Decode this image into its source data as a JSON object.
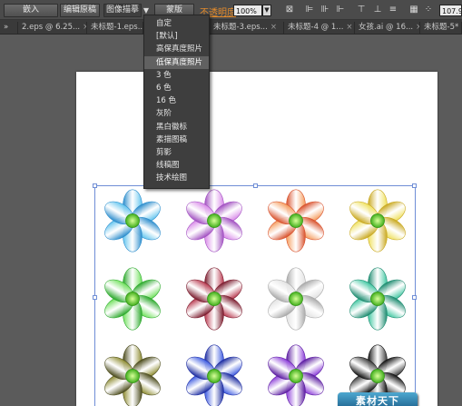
{
  "toolbar": {
    "embed_button": "嵌入",
    "edit_original_button": "编辑原稿",
    "image_trace_button": "图像描摹",
    "mask_button": "蒙版",
    "opacity_label": "不透明度",
    "opacity_value": "100%",
    "number_value": "107.9"
  },
  "tabs": [
    {
      "label": "2.eps @ 6.25..."
    },
    {
      "label": "未标题-1.eps..."
    },
    {
      "label": "未标题-3.eps..."
    },
    {
      "label": "未标题-4 @ 1..."
    },
    {
      "label": "女孩.ai @ 16..."
    },
    {
      "label": "未标题-5*"
    }
  ],
  "trace_menu": {
    "items": [
      {
        "label": "自定"
      },
      {
        "label": "[默认]"
      },
      {
        "label": "高保真度照片"
      },
      {
        "label": "低保真度照片",
        "highlighted": true
      },
      {
        "label": "3 色"
      },
      {
        "label": "6 色"
      },
      {
        "label": "16 色"
      },
      {
        "label": "灰阶"
      },
      {
        "label": "黑白徽标"
      },
      {
        "label": "素描图稿"
      },
      {
        "label": "剪影"
      },
      {
        "label": "线稿图"
      },
      {
        "label": "技术绘图"
      }
    ]
  },
  "watermark": {
    "text": "素材天下"
  },
  "flowers": [
    {
      "petal": "#5fc3ee",
      "edge": "#2a8ccc"
    },
    {
      "petal": "#d888e8",
      "edge": "#a04ec0"
    },
    {
      "petal": "#f59a5a",
      "edge": "#d8502a"
    },
    {
      "petal": "#efe05a",
      "edge": "#c9a81e"
    },
    {
      "petal": "#6ee05a",
      "edge": "#2aa82a"
    },
    {
      "petal": "#b8384e",
      "edge": "#7a1a2c"
    },
    {
      "petal": "#e2e2e2",
      "edge": "#a8a8a8"
    },
    {
      "petal": "#3ec6a0",
      "edge": "#1a8a6e"
    },
    {
      "petal": "#8c8a2e",
      "edge": "#4a4a1a"
    },
    {
      "petal": "#3a58e0",
      "edge": "#1a2aa0"
    },
    {
      "petal": "#8a3ad8",
      "edge": "#5a1aa0"
    },
    {
      "petal": "#3a3a3a",
      "edge": "#111111"
    }
  ],
  "icons": [
    "align-icon",
    "distribute-icon",
    "transform-icon",
    "grid-icon"
  ]
}
